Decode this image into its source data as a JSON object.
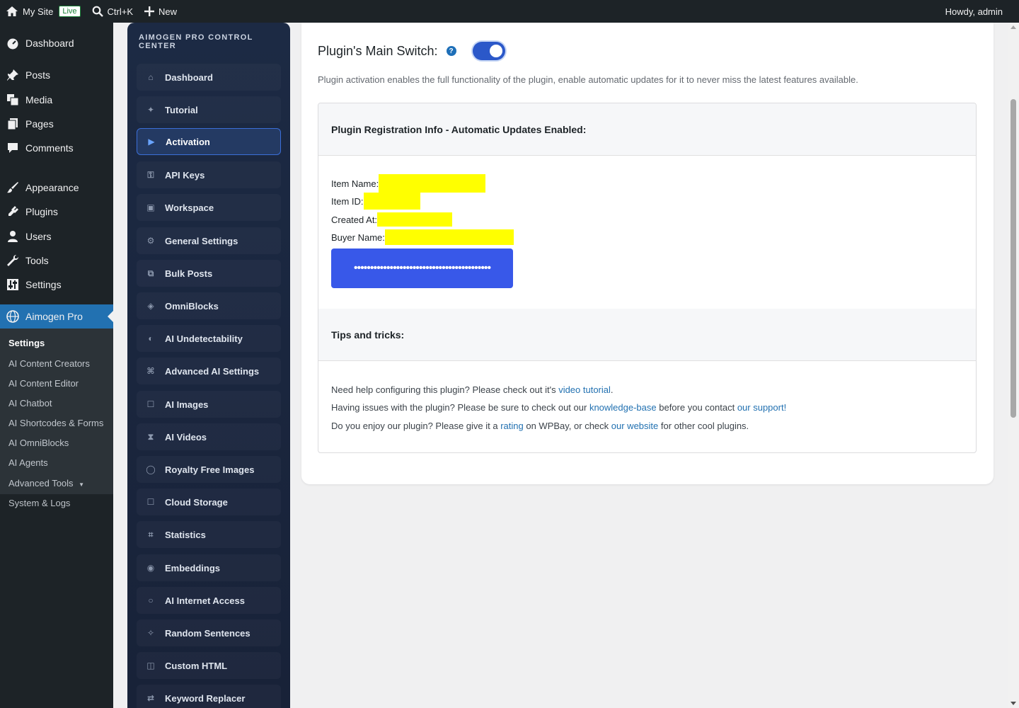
{
  "adminbar": {
    "site_name": "My Site",
    "live_badge": "Live",
    "search_shortcut": "Ctrl+K",
    "new_label": "New",
    "howdy": "Howdy, admin"
  },
  "wp_menu": {
    "items": [
      "Dashboard",
      "Posts",
      "Media",
      "Pages",
      "Comments",
      "Appearance",
      "Plugins",
      "Users",
      "Tools",
      "Settings",
      "Aimogen Pro"
    ],
    "submenu": [
      "Settings",
      "AI Content Creators",
      "AI Content Editor",
      "AI Chatbot",
      "AI Shortcodes & Forms",
      "AI OmniBlocks",
      "AI Agents",
      "Advanced Tools",
      "System & Logs"
    ]
  },
  "plugin_nav": {
    "title": "AIMOGEN PRO CONTROL CENTER",
    "items": [
      "Dashboard",
      "Tutorial",
      "Activation",
      "API Keys",
      "Workspace",
      "General Settings",
      "Bulk Posts",
      "OmniBlocks",
      "AI Undetectability",
      "Advanced AI Settings",
      "AI Images",
      "AI Videos",
      "Royalty Free Images",
      "Cloud Storage",
      "Statistics",
      "Embeddings",
      "AI Internet Access",
      "Random Sentences",
      "Custom HTML",
      "Keyword Replacer"
    ],
    "active": "Activation"
  },
  "main": {
    "switch_label": "Plugin's Main Switch:",
    "help_glyph": "?",
    "switch_on": true,
    "description": "Plugin activation enables the full functionality of the plugin, enable automatic updates for it to never miss the latest features available.",
    "registration_title": "Plugin Registration Info - Automatic Updates Enabled:",
    "item_name_label": "Item Name:",
    "item_id_label": "Item ID:",
    "created_at_label": "Created At:",
    "buyer_name_label": "Buyer Name:",
    "license_key_masked": "••••••••••••••••••••••••••••••••••••••••••",
    "tips_title": "Tips and tricks:",
    "tip1_prefix": "Need help configuring this plugin? Please check out it's ",
    "tip1_link": "video tutorial",
    "tip1_suffix": ".",
    "tip2_prefix": "Having issues with the plugin? Please be sure to check out our ",
    "tip2_link1": "knowledge-base",
    "tip2_mid": " before you contact ",
    "tip2_link2": "our support!",
    "tip3_prefix": "Do you enjoy our plugin? Please give it a ",
    "tip3_link1": "rating",
    "tip3_mid": " on WPBay, or check ",
    "tip3_link2": "our website",
    "tip3_suffix": " for other cool plugins."
  },
  "colors": {
    "accent": "#2271b1",
    "button": "#3858e9",
    "redaction": "#ffff00"
  }
}
